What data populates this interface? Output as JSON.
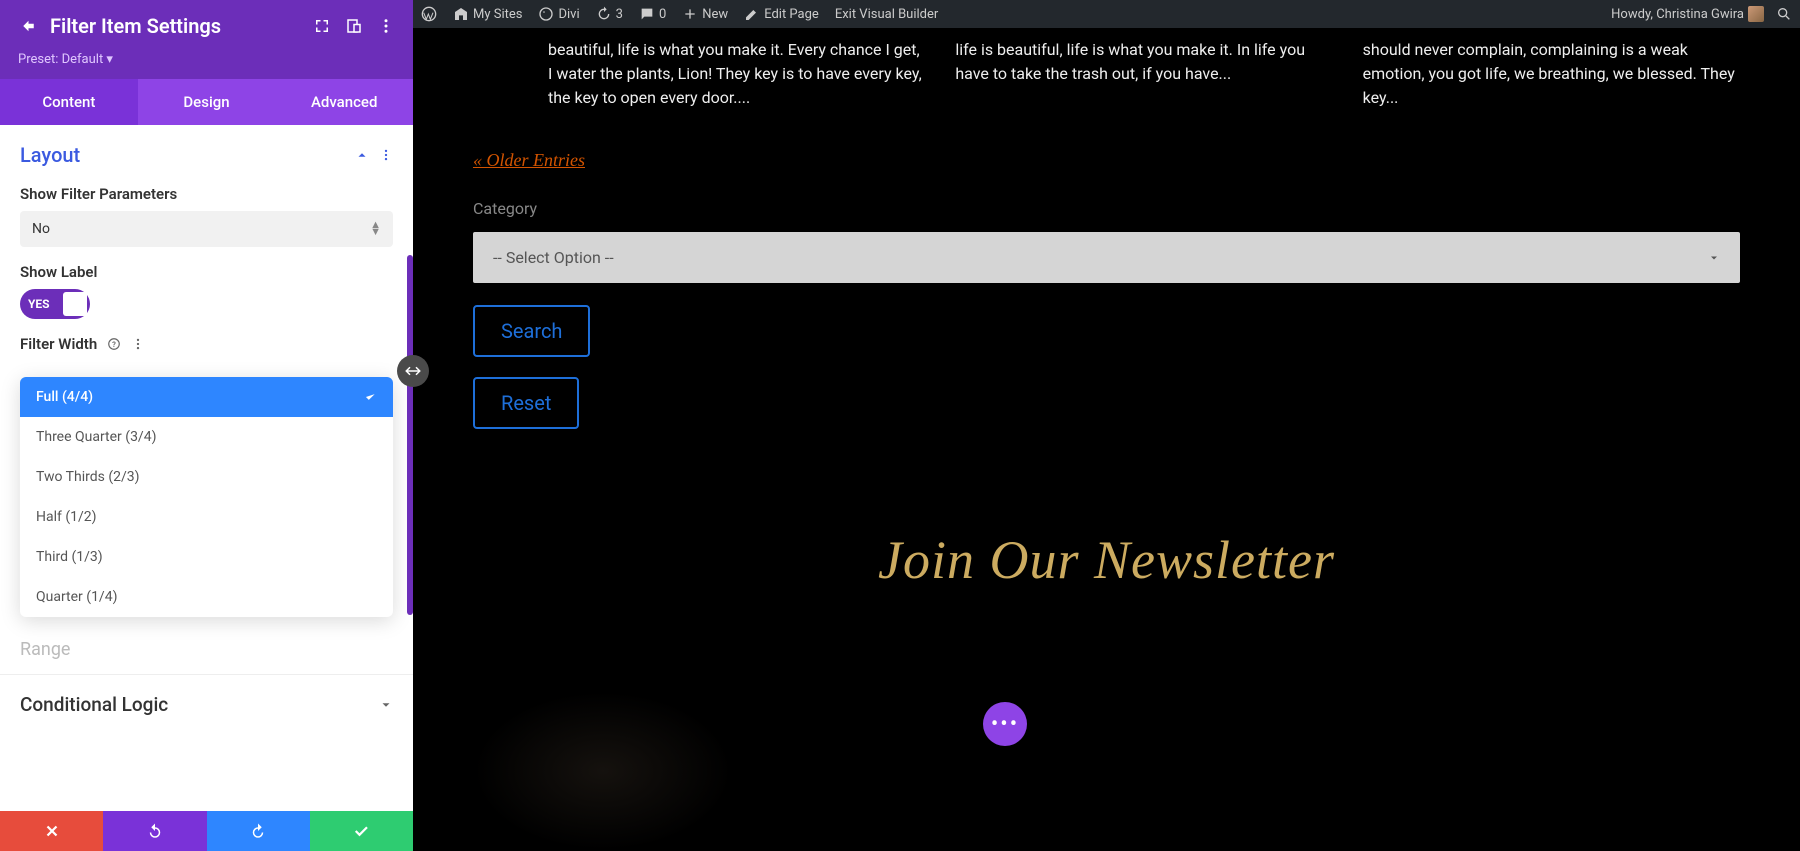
{
  "wp_bar": {
    "my_sites": "My Sites",
    "divi": "Divi",
    "updates_count": "3",
    "comments_count": "0",
    "new": "New",
    "edit_page": "Edit Page",
    "exit_vb": "Exit Visual Builder",
    "howdy": "Howdy, Christina Gwira"
  },
  "panel": {
    "title": "Filter Item Settings",
    "preset": "Preset: Default ▾",
    "tabs": {
      "content": "Content",
      "design": "Design",
      "advanced": "Advanced"
    },
    "sections": {
      "layout": "Layout",
      "range": "Range",
      "conditional": "Conditional Logic"
    },
    "fields": {
      "show_filter_params": {
        "label": "Show Filter Parameters",
        "value": "No"
      },
      "show_label": {
        "label": "Show Label",
        "toggle_text": "YES"
      },
      "filter_width": {
        "label": "Filter Width",
        "options": [
          "Full (4/4)",
          "Three Quarter (3/4)",
          "Two Thirds (2/3)",
          "Half (1/2)",
          "Third (1/3)",
          "Quarter (1/4)"
        ]
      }
    }
  },
  "preview": {
    "posts": [
      "beautiful, life is what you make it. Every chance I get, I water the plants, Lion! They key is to have every key, the key to open every door....",
      "life is beautiful, life is what you make it. In life you have to take the trash out, if you have...",
      "should never complain, complaining is a weak emotion, you got life, we breathing, we blessed. They key..."
    ],
    "older_entries": "« Older Entries",
    "category_label": "Category",
    "select_placeholder": "-- Select Option --",
    "search_btn": "Search",
    "reset_btn": "Reset",
    "newsletter": "Join Our Newsletter"
  }
}
